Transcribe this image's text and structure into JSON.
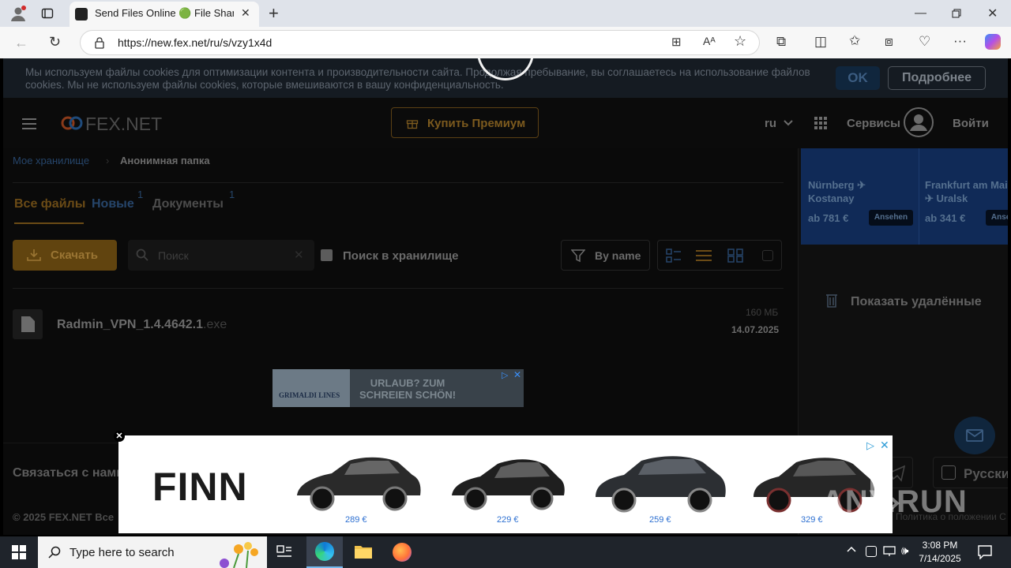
{
  "browser": {
    "tab_title": "Send Files Online 🟢 File Sharing",
    "url": "https://new.fex.net/ru/s/vzy1x4d"
  },
  "cookie_banner": {
    "text": "Мы используем файлы cookies для оптимизации контента и производительности сайта. Продолжая пребывание, вы соглашаетесь на использование файлов cookies. Мы не используем файлы cookies, которые вмешиваются в вашу конфиденциальность.",
    "ok_label": "OK",
    "more_label": "Подробнее"
  },
  "header": {
    "logo_text": "FEX.NET",
    "premium_label": "Купить Премиум",
    "lang": "ru",
    "services_label": "Сервисы",
    "login_label": "Войти"
  },
  "breadcrumb": {
    "root": "Мое хранилище",
    "current": "Анонимная папка"
  },
  "tabs": [
    {
      "label": "Все файлы",
      "count": ""
    },
    {
      "label": "Новые",
      "count": "1"
    },
    {
      "label": "Документы",
      "count": "1"
    }
  ],
  "toolbar": {
    "download_label": "Скачать",
    "search_placeholder": "Поиск",
    "storage_search_label": "Поиск в хранилище",
    "sort_label": "By name"
  },
  "files": [
    {
      "name": "Radmin_VPN_1.4.4642.1",
      "ext": ".exe",
      "size": "160 МБ",
      "date": "14.07.2025"
    }
  ],
  "ad_small": {
    "brand": "GRIMALDI LINES",
    "text_line1": "URLAUB? ZUM",
    "text_line2": "SCHREIEN SCHÖN!"
  },
  "sidebar": {
    "promo": [
      {
        "route": "Nürnberg ✈ Kostanay",
        "price": "ab 781 €",
        "cta": "Ansehen"
      },
      {
        "route": "Frankfurt am Main ✈ Uralsk",
        "price": "ab 341 €",
        "cta": "Ansehen"
      }
    ],
    "show_deleted_label": "Показать удалённые"
  },
  "footer": {
    "contact_label": "Связаться с нами",
    "copyright": "© 2025 FEX.NET Все",
    "language_label": "Русский",
    "policy_text": "Политика о положении С"
  },
  "ad_big": {
    "brand": "FINN",
    "prices": [
      "289 €",
      "229 €",
      "259 €",
      "329 €"
    ]
  },
  "watermark": "ANY.RUN",
  "taskbar": {
    "search_placeholder": "Type here to search",
    "time": "3:08 PM",
    "date": "7/14/2025"
  }
}
